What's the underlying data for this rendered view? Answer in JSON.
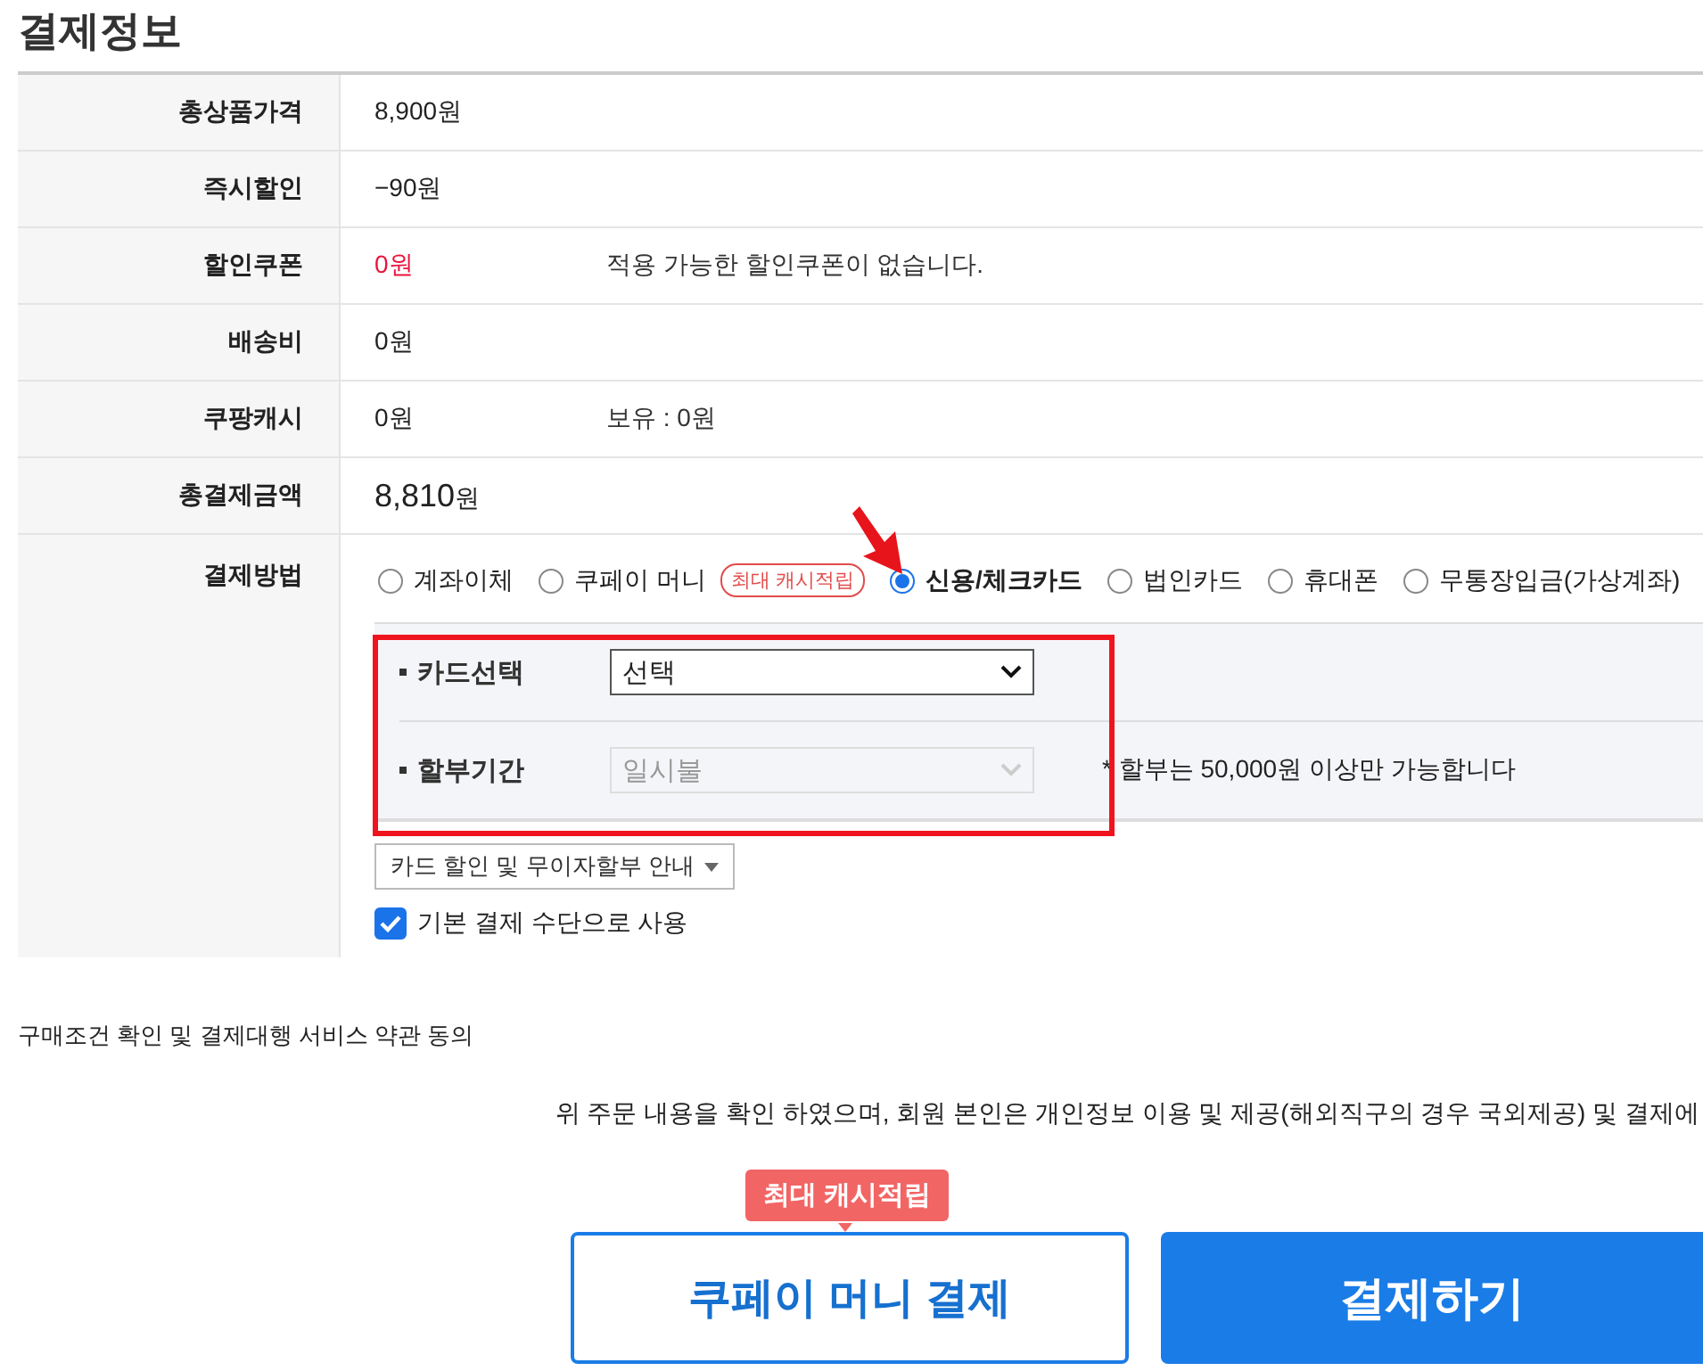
{
  "title": "결제정보",
  "rows": [
    {
      "label": "총상품가격",
      "value": "8,900원"
    },
    {
      "label": "즉시할인",
      "value": "−90원"
    },
    {
      "label": "할인쿠폰",
      "value": "0원",
      "highlight": true,
      "note": "적용 가능한 할인쿠폰이 없습니다."
    },
    {
      "label": "배송비",
      "value": "0원"
    },
    {
      "label": "쿠팡캐시",
      "value": "0원",
      "note": "보유 : 0원"
    },
    {
      "label": "총결제금액",
      "value": "8,810",
      "unit": "원",
      "kind": "total"
    }
  ],
  "payment": {
    "label": "결제방법",
    "methods": [
      {
        "label": "계좌이체",
        "selected": false
      },
      {
        "label": "쿠페이 머니",
        "selected": false,
        "badge": "최대 캐시적립"
      },
      {
        "label": "신용/체크카드",
        "selected": true
      },
      {
        "label": "법인카드",
        "selected": false
      },
      {
        "label": "휴대폰",
        "selected": false
      },
      {
        "label": "무통장입금(가상계좌)",
        "selected": false
      }
    ],
    "fields": [
      {
        "label": "카드선택",
        "value": "선택",
        "disabled": false
      },
      {
        "label": "할부기간",
        "value": "일시불",
        "disabled": true,
        "note": "* 할부는 50,000원 이상만 가능합니다"
      }
    ],
    "guide_button": "카드 할인 및 무이자할부 안내",
    "default_checkbox": {
      "label": "기본 결제 수단으로 사용",
      "checked": true
    }
  },
  "terms_title": "구매조건 확인 및 결제대행 서비스 약관 동의",
  "terms_text": "위 주문 내용을 확인 하였으며, 회원 본인은 개인정보 이용 및 제공(해외직구의 경우 국외제공) 및 결제에",
  "coupay_button": {
    "label": "쿠페이 머니 결제",
    "badge": "최대 캐시적립"
  },
  "pay_button": "결제하기"
}
